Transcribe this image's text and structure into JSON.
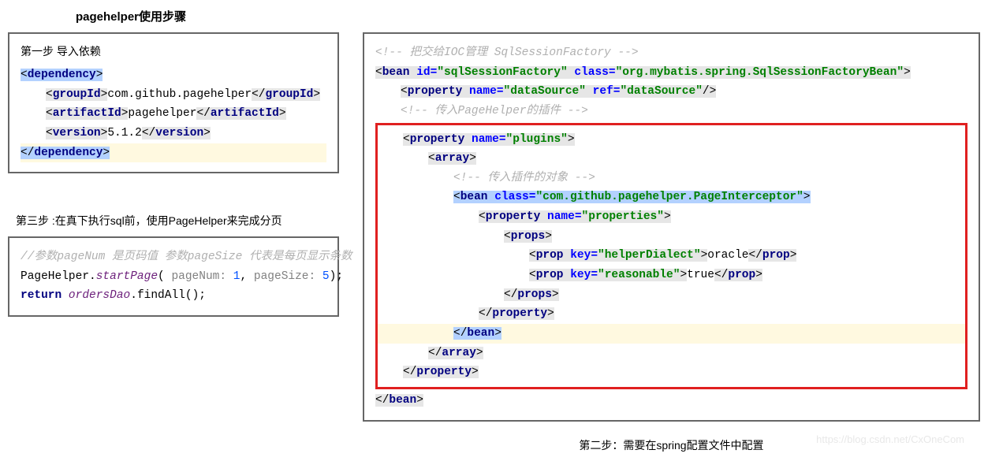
{
  "title": "pagehelper使用步骤",
  "step1": {
    "heading": "第一步 导入依赖",
    "dep_open": "dependency",
    "groupId_tag": "groupId",
    "groupId_val": "com.github.pagehelper",
    "artifactId_tag": "artifactId",
    "artifactId_val": "pagehelper",
    "version_tag": "version",
    "version_val": "5.1.2",
    "dep_close": "dependency"
  },
  "step3": {
    "title": "第三步 :在真下执行sql前，使用PageHelper来完成分页",
    "comment": "//参数pageNum 是页码值   参数pageSize 代表是每页显示条数",
    "ph": "PageHelper.",
    "startPage": "startPage",
    "p1label": "pageNum:",
    "p1val": "1",
    "p2label": "pageSize:",
    "p2val": "5",
    "ret": "return",
    "dao": "ordersDao",
    "findAll": ".findAll();"
  },
  "step2": {
    "title": "第二步：需要在spring配置文件中配置",
    "c1": "<!-- 把交给IOC管理 SqlSessionFactory -->",
    "bean": "bean",
    "id": "id=",
    "idv": "\"sqlSessionFactory\"",
    "cls": "class=",
    "clsv": "\"org.mybatis.spring.SqlSessionFactoryBean\"",
    "property": "property",
    "name": "name=",
    "dsn": "\"dataSource\"",
    "ref": "ref=",
    "dsr": "\"dataSource\"",
    "c2": "<!-- 传入PageHelper的插件 -->",
    "plugins": "\"plugins\"",
    "array": "array",
    "c3": "<!-- 传入插件的对象 -->",
    "intercls": "\"com.github.pagehelper.PageInterceptor\"",
    "propsname": "\"properties\"",
    "props": "props",
    "prop": "prop",
    "key": "key=",
    "kdialect": "\"helperDialect\"",
    "vdialect": "oracle",
    "kreason": "\"reasonable\"",
    "vreason": "true"
  },
  "watermark": "https://blog.csdn.net/CxOneCom"
}
